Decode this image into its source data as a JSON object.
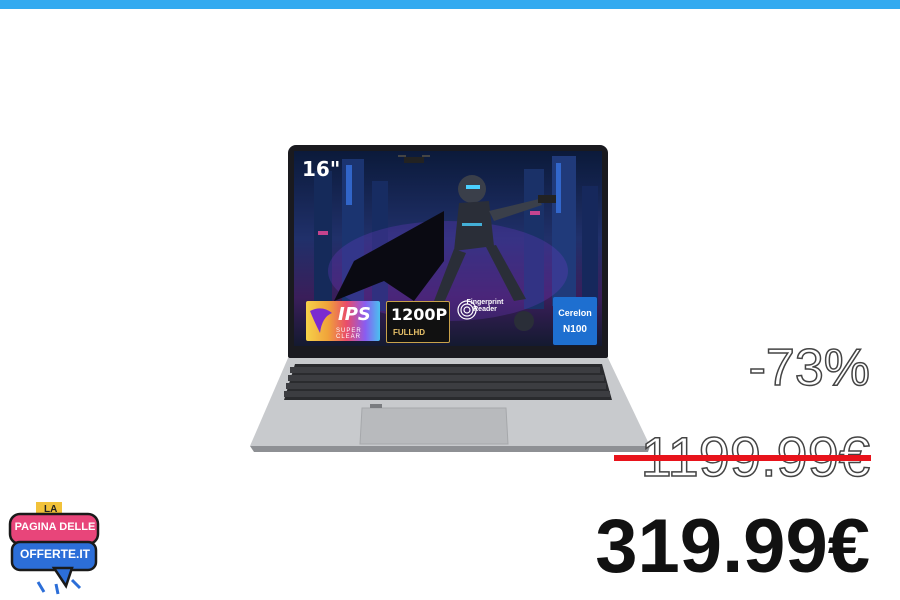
{
  "colors": {
    "topbar": "#33aaf0",
    "strike": "#e8131b",
    "logo_pink": "#e8457a",
    "logo_blue": "#2c6ed8",
    "cpu_badge": "#1e6fd0"
  },
  "product": {
    "screen_size": "16\"",
    "badges": {
      "ips_title": "IPS",
      "ips_sub": "SUPER CLEAR",
      "resolution": "1200P",
      "resolution_sub": "FULLHD",
      "fingerprint_line1": "Fingerprint",
      "fingerprint_line2": "Reader",
      "fingerprint_icon": "fingerprint-icon",
      "cpu_line1": "Cerelon",
      "cpu_line2": "N100"
    }
  },
  "pricing": {
    "discount": "-73%",
    "old_price": "1199.99€",
    "new_price": "319.99€"
  },
  "logo": {
    "top": "LA",
    "line1": "PAGINA DELLE",
    "line2": "OFFERTE.IT"
  }
}
